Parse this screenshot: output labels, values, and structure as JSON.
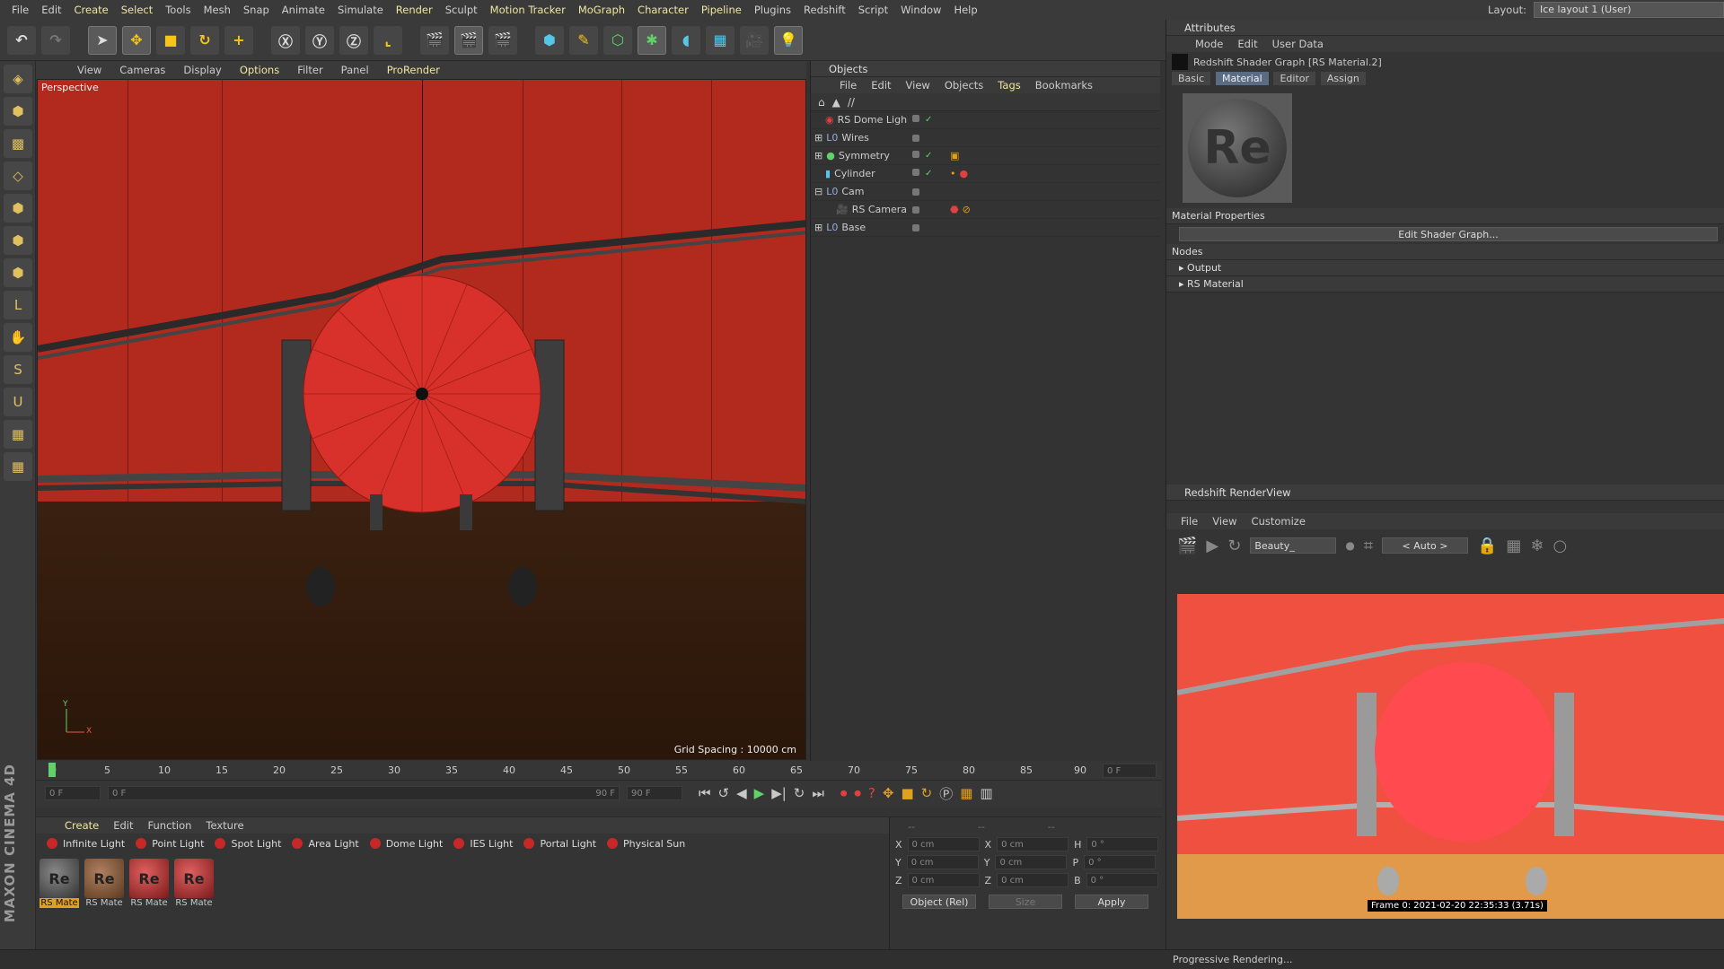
{
  "menubar": {
    "items": [
      "File",
      "Edit",
      "Create",
      "Select",
      "Tools",
      "Mesh",
      "Snap",
      "Animate",
      "Simulate",
      "Render",
      "Sculpt",
      "Motion Tracker",
      "MoGraph",
      "Character",
      "Pipeline",
      "Plugins",
      "Redshift",
      "Script",
      "Window",
      "Help"
    ],
    "layout_label": "Layout:",
    "layout_value": "Ice layout 1 (User)"
  },
  "viewport": {
    "menu": [
      "View",
      "Cameras",
      "Display",
      "Options",
      "Filter",
      "Panel",
      "ProRender"
    ],
    "label": "Perspective",
    "grid_spacing": "Grid Spacing : 10000 cm",
    "axis_x": "X",
    "axis_y": "Y"
  },
  "objects": {
    "title": "Objects",
    "menu": [
      "File",
      "Edit",
      "View",
      "Objects",
      "Tags",
      "Bookmarks"
    ],
    "path": "//",
    "rows": [
      {
        "name": "RS Dome Ligh",
        "icon": "dome-light-icon"
      },
      {
        "name": "Wires",
        "icon": "null-icon"
      },
      {
        "name": "Symmetry",
        "icon": "symmetry-icon"
      },
      {
        "name": "Cylinder",
        "icon": "cylinder-icon"
      },
      {
        "name": "Cam",
        "icon": "null-icon"
      },
      {
        "name": "RS Camera",
        "icon": "camera-icon"
      },
      {
        "name": "Base",
        "icon": "null-icon"
      }
    ]
  },
  "attributes": {
    "title": "Attributes",
    "menu": [
      "Mode",
      "Edit",
      "User Data"
    ],
    "object_title": "Redshift Shader Graph [RS Material.2]",
    "tabs": [
      "Basic",
      "Material",
      "Editor",
      "Assign"
    ],
    "selected_tab": "Material",
    "preview_text": "Re",
    "material_properties": "Material Properties",
    "edit_button": "Edit Shader Graph...",
    "nodes": "Nodes",
    "node_items": [
      "Output",
      "RS Material"
    ]
  },
  "renderview": {
    "title": "Redshift RenderView",
    "menu": [
      "File",
      "View",
      "Customize"
    ],
    "aov": "Beauty_",
    "camera": "< Auto >",
    "frame_info": "Frame  0:  2021-02-20  22:35:33  (3.71s)",
    "status": "Progressive Rendering..."
  },
  "timeline": {
    "ticks": [
      "0",
      "5",
      "10",
      "15",
      "20",
      "25",
      "30",
      "35",
      "40",
      "45",
      "50",
      "55",
      "60",
      "65",
      "70",
      "75",
      "80",
      "85",
      "90"
    ],
    "current_frame": "0 F",
    "start": "0 F",
    "range_start": "0 F",
    "range_end": "90 F",
    "end": "90 F"
  },
  "material_manager": {
    "menu": [
      "Create",
      "Edit",
      "Function",
      "Texture"
    ],
    "lights": [
      "Infinite Light",
      "Point Light",
      "Spot Light",
      "Area Light",
      "Dome Light",
      "IES Light",
      "Portal Light",
      "Physical Sun"
    ],
    "materials": [
      "RS Mate",
      "RS Mate",
      "RS Mate",
      "RS Mate"
    ],
    "swatch_text": "Re"
  },
  "coordinates": {
    "header": [
      "--",
      "--",
      "--"
    ],
    "rows": [
      {
        "a": "X",
        "av": "0 cm",
        "b": "X",
        "bv": "0 cm",
        "c": "H",
        "cv": "0 °"
      },
      {
        "a": "Y",
        "av": "0 cm",
        "b": "Y",
        "bv": "0 cm",
        "c": "P",
        "cv": "0 °"
      },
      {
        "a": "Z",
        "av": "0 cm",
        "b": "Z",
        "bv": "0 cm",
        "c": "B",
        "cv": "0 °"
      }
    ],
    "mode": "Object (Rel)",
    "size": "Size",
    "apply": "Apply"
  },
  "branding": "MAXON CINEMA 4D",
  "colors": {
    "accent": "#5a6c84",
    "wall": "#b22a1e",
    "render_bg": "#f05040"
  }
}
